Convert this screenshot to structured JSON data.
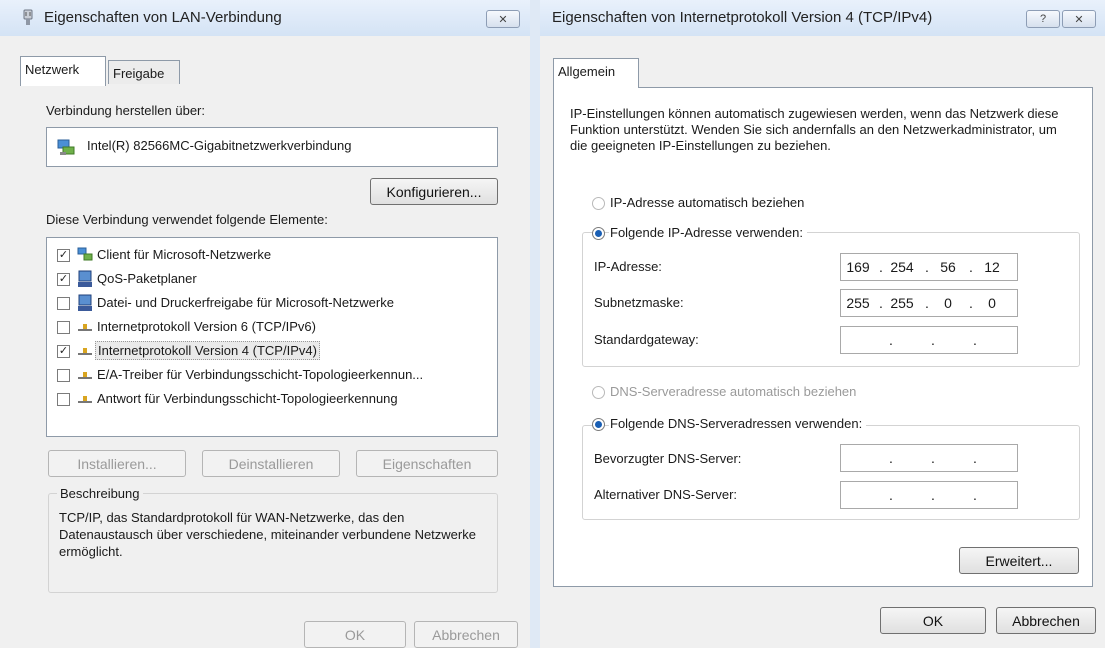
{
  "lan_dialog": {
    "title": "Eigenschaften von LAN-Verbindung",
    "tabs": [
      "Netzwerk",
      "Freigabe"
    ],
    "connect_label": "Verbindung herstellen über:",
    "adapter": "Intel(R) 82566MC-Gigabitnetzwerkverbindung",
    "configure_button": "Konfigurieren...",
    "elements_label": "Diese Verbindung verwendet folgende Elemente:",
    "items": [
      {
        "label": "Client für Microsoft-Netzwerke",
        "checked": true
      },
      {
        "label": "QoS-Paketplaner",
        "checked": true
      },
      {
        "label": "Datei- und Druckerfreigabe für Microsoft-Netzwerke",
        "checked": false
      },
      {
        "label": "Internetprotokoll Version 6 (TCP/IPv6)",
        "checked": false
      },
      {
        "label": "Internetprotokoll Version 4 (TCP/IPv4)",
        "checked": true
      },
      {
        "label": "E/A-Treiber für Verbindungsschicht-Topologieerkennun...",
        "checked": false
      },
      {
        "label": "Antwort für Verbindungsschicht-Topologieerkennung",
        "checked": false
      }
    ],
    "install_button": "Installieren...",
    "uninstall_button": "Deinstallieren",
    "properties_button": "Eigenschaften",
    "description_label": "Beschreibung",
    "description_text": "TCP/IP, das Standardprotokoll für WAN-Netzwerke, das den Datenaustausch über verschiedene, miteinander verbundene Netzwerke ermöglicht.",
    "ok_button": "OK",
    "cancel_button": "Abbrechen"
  },
  "ipv4_dialog": {
    "title": "Eigenschaften von Internetprotokoll Version 4 (TCP/IPv4)",
    "help_icon": "?",
    "tab": "Allgemein",
    "intro": "IP-Einstellungen können automatisch zugewiesen werden, wenn das Netzwerk diese Funktion unterstützt. Wenden Sie sich andernfalls an den Netzwerkadministrator, um die geeigneten IP-Einstellungen zu beziehen.",
    "radio_auto_ip": "IP-Adresse automatisch beziehen",
    "radio_manual_ip": "Folgende IP-Adresse verwenden:",
    "ip_label": "IP-Adresse:",
    "ip_value": [
      "169",
      "254",
      "56",
      "12"
    ],
    "subnet_label": "Subnetzmaske:",
    "subnet_value": [
      "255",
      "255",
      "0",
      "0"
    ],
    "gateway_label": "Standardgateway:",
    "gateway_value": [
      "",
      "",
      "",
      ""
    ],
    "radio_auto_dns": "DNS-Serveradresse automatisch beziehen",
    "radio_manual_dns": "Folgende DNS-Serveradressen verwenden:",
    "preferred_dns_label": "Bevorzugter DNS-Server:",
    "preferred_dns_value": [
      "",
      "",
      "",
      ""
    ],
    "alternate_dns_label": "Alternativer DNS-Server:",
    "alternate_dns_value": [
      "",
      "",
      "",
      ""
    ],
    "advanced_button": "Erweitert...",
    "ok_button": "OK",
    "cancel_button": "Abbrechen"
  },
  "icons": {
    "lan_title_icon": "network-adapter-icon",
    "adapter_icon": "network-card-icon",
    "client_icon": "network-client-icon",
    "service_icon": "computer-service-icon",
    "protocol_icon": "protocol-icon",
    "close_icon": "close-icon",
    "help_icon": "help-icon"
  },
  "colors": {
    "accent": "#1a5fb4",
    "titlebar": "#d4e3f5",
    "window": "#f0f0f0"
  }
}
